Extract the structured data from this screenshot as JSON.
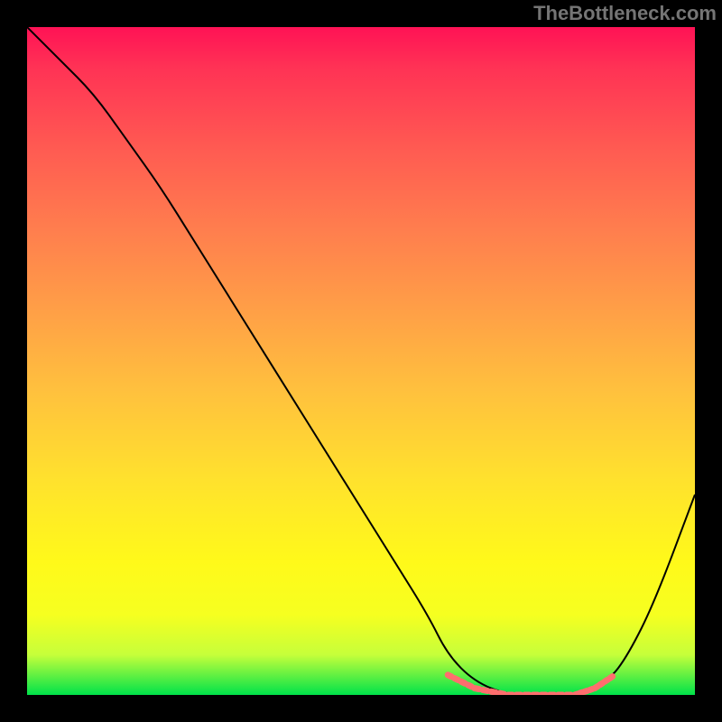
{
  "watermark": "TheBottleneck.com",
  "chart_data": {
    "type": "line",
    "title": "",
    "xlabel": "",
    "ylabel": "",
    "xlim": [
      0,
      100
    ],
    "ylim": [
      0,
      100
    ],
    "grid": false,
    "gradient_colors": {
      "top": "#ff1255",
      "mid_top": "#ff7d4e",
      "mid": "#ffe22d",
      "mid_bottom": "#f6ff20",
      "bottom": "#00e24a"
    },
    "series": [
      {
        "name": "curve",
        "color": "#000000",
        "x": [
          0,
          5,
          10,
          15,
          20,
          25,
          30,
          35,
          40,
          45,
          50,
          55,
          60,
          63,
          67,
          72,
          77,
          82,
          87,
          90,
          94,
          100
        ],
        "y_pct": [
          100,
          95,
          90,
          83,
          76,
          68,
          60,
          52,
          44,
          36,
          28,
          20,
          12,
          6,
          2,
          0,
          0,
          0,
          2,
          6,
          14,
          30
        ]
      },
      {
        "name": "highlight-flat",
        "color": "#ff6e6e",
        "style": "dashed-dots",
        "x": [
          63,
          67,
          72,
          77,
          82,
          85,
          88
        ],
        "y_pct": [
          3,
          1,
          0,
          0,
          0,
          1,
          3
        ]
      }
    ],
    "annotations": []
  }
}
